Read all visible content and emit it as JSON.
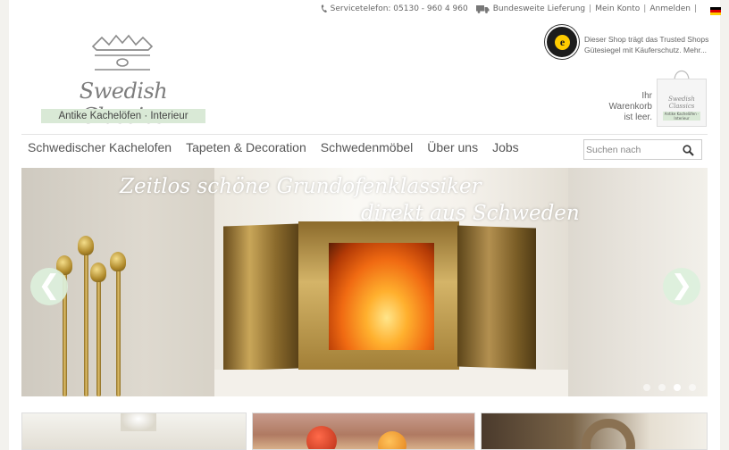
{
  "topbar": {
    "phone_label": "Servicetelefon: 05130 - 960 4 960",
    "delivery_label": "Bundesweite Lieferung",
    "account_label": "Mein Konto",
    "login_label": "Anmelden",
    "separator": "|"
  },
  "header": {
    "logo_name": "Swedish Classics",
    "logo_tagline": "Antike Kachelöfen · Interieur",
    "trusted_line1": "Dieser Shop trägt das Trusted Shops",
    "trusted_line2": "Gütesiegel mit Käuferschutz. Mehr...",
    "trusted_seal_letter": "e",
    "cart_line1": "Ihr",
    "cart_line2": "Warenkorb",
    "cart_line3": "ist leer.",
    "cart_bag_logo": "Swedish Classics",
    "cart_bag_tagline": "Antike Kachelöfen · Interieur"
  },
  "nav": {
    "items": [
      {
        "label": "Schwedischer Kachelofen"
      },
      {
        "label": "Tapeten & Decoration"
      },
      {
        "label": "Schwedenmöbel"
      },
      {
        "label": "Über uns"
      },
      {
        "label": "Jobs"
      }
    ]
  },
  "search": {
    "placeholder": "Suchen nach",
    "icon": "search-icon"
  },
  "slider": {
    "title_line1": "Zeitlos schöne Grundofenklassiker",
    "title_line2": "direkt aus Schweden",
    "prev_glyph": "❮",
    "next_glyph": "❯",
    "slide_count": 4,
    "active_slide": 3
  },
  "colors": {
    "accent_green": "#d9e9d6",
    "text_gray": "#555555",
    "trusted_yellow": "#ffcc00",
    "flag_black": "#000000",
    "flag_red": "#dd0000",
    "flag_gold": "#ffce00"
  }
}
